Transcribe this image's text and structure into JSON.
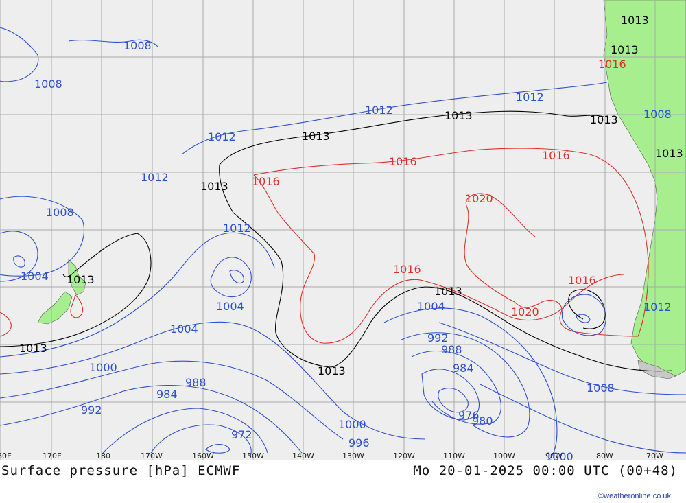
{
  "title": "Surface pressure [hPa] ECMWF",
  "run_time": "Mo 20-01-2025 00:00 UTC (00+48)",
  "credit": "©weatheronline.co.uk",
  "colors": {
    "background": "#eeeeee",
    "land": "#a6ee8e",
    "grid": "#a9a9a9",
    "low_isobar": "#2d4fd4",
    "mid_isobar": "#000000",
    "high_isobar": "#e0302a"
  },
  "longitude_labels": [
    "60E",
    "170E",
    "180",
    "170W",
    "160W",
    "150W",
    "140W",
    "130W",
    "120W",
    "110W",
    "100W",
    "90W",
    "80W",
    "70W"
  ],
  "isobar_labels": [
    {
      "text": "1008",
      "class": "low"
    },
    {
      "text": "1008",
      "class": "low"
    },
    {
      "text": "1012",
      "class": "low"
    },
    {
      "text": "1012",
      "class": "low"
    },
    {
      "text": "1012",
      "class": "low"
    },
    {
      "text": "1012",
      "class": "low"
    },
    {
      "text": "1012",
      "class": "low"
    },
    {
      "text": "1008",
      "class": "low"
    },
    {
      "text": "1004",
      "class": "low"
    },
    {
      "text": "1004",
      "class": "low"
    },
    {
      "text": "1004",
      "class": "low"
    },
    {
      "text": "1000",
      "class": "low"
    },
    {
      "text": "992",
      "class": "low"
    },
    {
      "text": "988",
      "class": "low"
    },
    {
      "text": "984",
      "class": "low"
    },
    {
      "text": "972",
      "class": "low"
    },
    {
      "text": "1000",
      "class": "low"
    },
    {
      "text": "996",
      "class": "low"
    },
    {
      "text": "1004",
      "class": "low"
    },
    {
      "text": "992",
      "class": "low"
    },
    {
      "text": "988",
      "class": "low"
    },
    {
      "text": "984",
      "class": "low"
    },
    {
      "text": "976",
      "class": "low"
    },
    {
      "text": "980",
      "class": "low"
    },
    {
      "text": "1008",
      "class": "low"
    },
    {
      "text": "1000",
      "class": "low"
    },
    {
      "text": "1008",
      "class": "low"
    },
    {
      "text": "1012",
      "class": "low"
    },
    {
      "text": "1013",
      "class": "mid"
    },
    {
      "text": "1013",
      "class": "mid"
    },
    {
      "text": "1013",
      "class": "mid"
    },
    {
      "text": "1013",
      "class": "mid"
    },
    {
      "text": "1013",
      "class": "mid"
    },
    {
      "text": "1013",
      "class": "mid"
    },
    {
      "text": "1013",
      "class": "mid"
    },
    {
      "text": "1013",
      "class": "mid"
    },
    {
      "text": "1013",
      "class": "mid"
    },
    {
      "text": "1013",
      "class": "mid"
    },
    {
      "text": "1013",
      "class": "mid"
    },
    {
      "text": "1016",
      "class": "high"
    },
    {
      "text": "1016",
      "class": "high"
    },
    {
      "text": "1016",
      "class": "high"
    },
    {
      "text": "1016",
      "class": "high"
    },
    {
      "text": "1016",
      "class": "high"
    },
    {
      "text": "1020",
      "class": "high"
    },
    {
      "text": "1020",
      "class": "high"
    },
    {
      "text": "1016",
      "class": "high"
    }
  ]
}
